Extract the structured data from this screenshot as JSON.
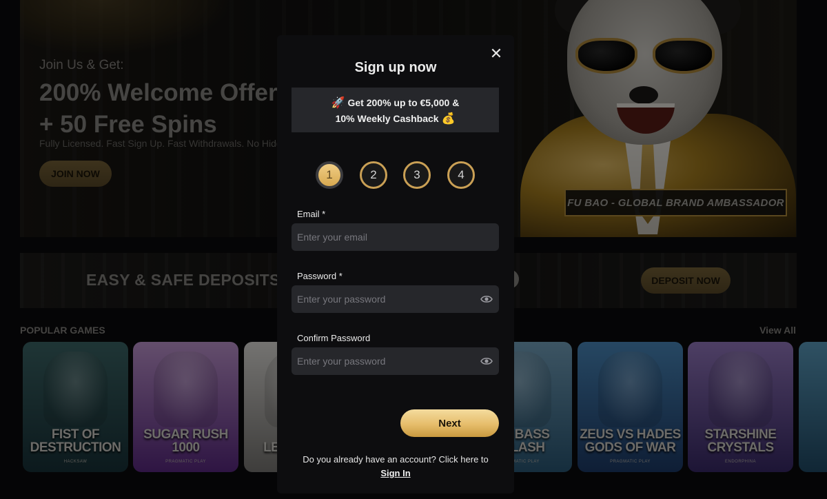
{
  "hero": {
    "subtitle": "Join Us & Get:",
    "title_line1": "200% Welcome Offer",
    "title_line2": "+ 50 Free Spins",
    "description": "Fully Licensed. Fast Sign Up. Fast Withdrawals. No Hidden Fees.",
    "join_button": "JOIN NOW",
    "ambassador_label": "FU BAO - GLOBAL BRAND AMBASSADOR"
  },
  "deposit": {
    "title": "EASY & SAFE DEPOSITS",
    "button": "DEPOSIT NOW"
  },
  "popular": {
    "title": "POPULAR GAMES",
    "view_all": "View All",
    "games": [
      {
        "name": "FIST OF DESTRUCTION",
        "provider": "HACKSAW",
        "color1": "#3e6a6b",
        "color2": "#18333a"
      },
      {
        "name": "SUGAR RUSH 1000",
        "provider": "PRAGMATIC PLAY",
        "color1": "#c89cd9",
        "color2": "#5d2a86"
      },
      {
        "name": "LE BANDIT",
        "provider": "",
        "color1": "#e8e6e2",
        "color2": "#7d7b78"
      },
      {
        "name": "BIG BASS SPLASH",
        "provider": "PRAGMATIC PLAY",
        "color1": "#79a9c6",
        "color2": "#2b5b7a"
      },
      {
        "name": "ZEUS VS HADES GODS OF WAR",
        "provider": "PRAGMATIC PLAY",
        "color1": "#4d8fc5",
        "color2": "#1d3c6b"
      },
      {
        "name": "STARSHINE CRYSTALS",
        "provider": "ENDORPHINA",
        "color1": "#9b7ec8",
        "color2": "#3a2a6b"
      }
    ]
  },
  "modal": {
    "title": "Sign up now",
    "promo_line1": "Get 200% up to €5,000 &",
    "promo_line2": "10% Weekly Cashback",
    "steps": [
      "1",
      "2",
      "3",
      "4"
    ],
    "active_step": 1,
    "email_label": "Email *",
    "email_placeholder": "Enter your email",
    "password_label": "Password *",
    "password_placeholder": "Enter your password",
    "confirm_label": "Confirm Password",
    "confirm_placeholder": "Enter your password",
    "next_button": "Next",
    "account_text": "Do you already have an account? Click here to",
    "signin_link": "Sign In",
    "close_icon": "close-icon"
  }
}
